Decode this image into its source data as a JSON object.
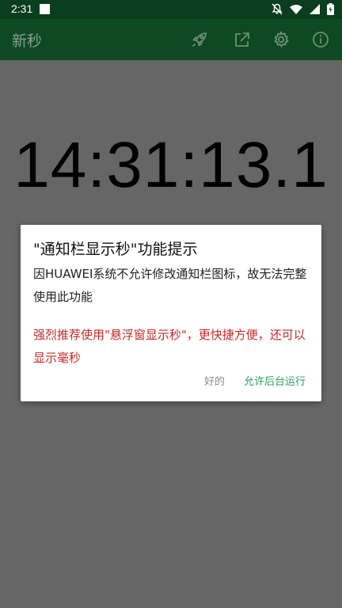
{
  "status_bar": {
    "time": "2:31"
  },
  "app_bar": {
    "title": "新秒"
  },
  "clock": {
    "display": "14:31:13.1"
  },
  "dialog": {
    "title": "\"通知栏显示秒\"功能提示",
    "message": "因HUAWEI系统不允许修改通知栏图标，故无法完整使用此功能",
    "recommend": "强烈推荐使用\"悬浮窗显示秒\"，更快捷方便，还可以显示毫秒",
    "ok_label": "好的",
    "allow_label": "允许后台运行"
  },
  "colors": {
    "status_bar": "#0b3d1f",
    "app_bar": "#0d4a24",
    "overlay": "#666666",
    "recommend_text": "#c62828",
    "positive_button": "#2e9d5a"
  },
  "icons": {
    "status": [
      "notification-square-icon",
      "mute-bell-icon",
      "wifi-icon",
      "cell-signal-icon",
      "battery-icon"
    ],
    "app_bar": [
      "rocket-icon",
      "share-icon",
      "gear-icon",
      "info-icon"
    ]
  }
}
